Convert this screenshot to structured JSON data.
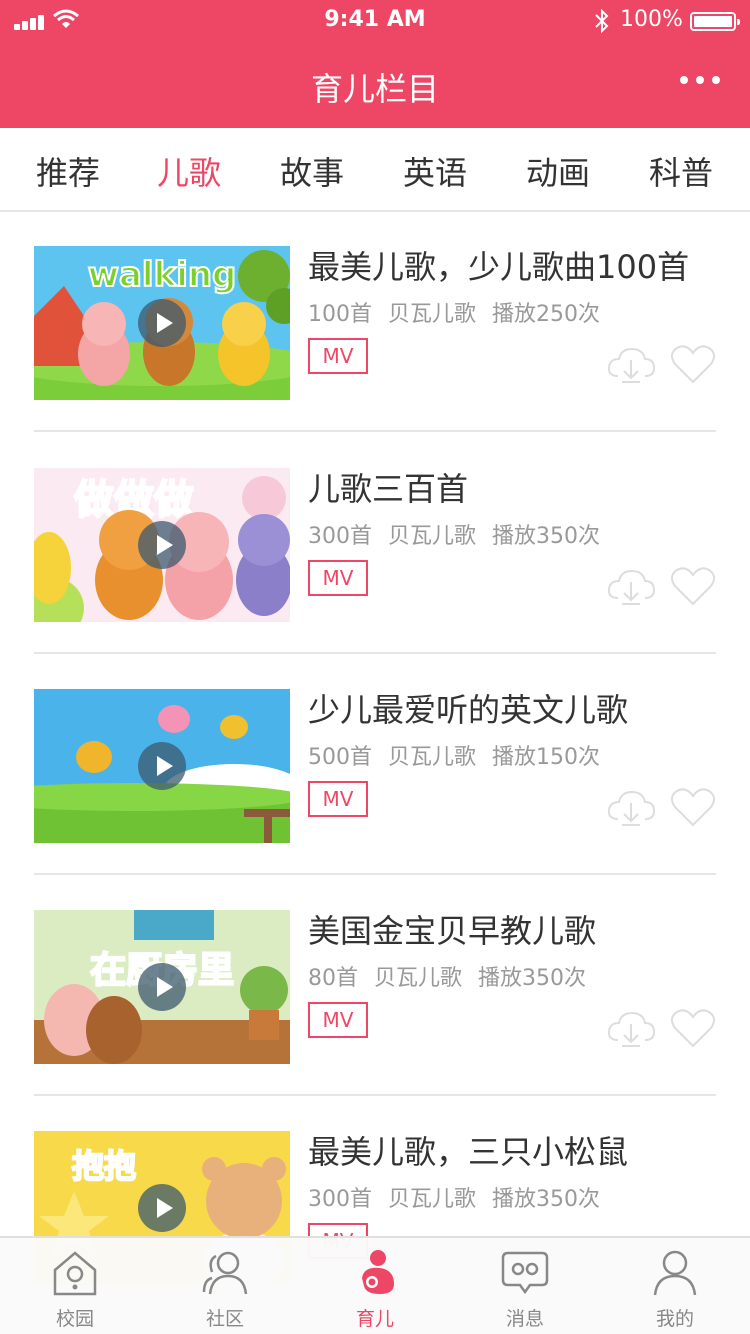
{
  "status_bar": {
    "time": "9:41 AM",
    "battery": "100%"
  },
  "nav": {
    "title": "育儿栏目"
  },
  "tabs": [
    {
      "label": "推荐"
    },
    {
      "label": "儿歌"
    },
    {
      "label": "故事"
    },
    {
      "label": "英语"
    },
    {
      "label": "动画"
    },
    {
      "label": "科普"
    }
  ],
  "active_tab": "儿歌",
  "items": [
    {
      "title": "最美儿歌，少儿歌曲100首",
      "count": "100首",
      "author": "贝瓦儿歌",
      "plays": "播放250次",
      "badge": "MV",
      "thumb_text": "walking"
    },
    {
      "title": "儿歌三百首",
      "count": "300首",
      "author": "贝瓦儿歌",
      "plays": "播放350次",
      "badge": "MV",
      "thumb_text": "做做做"
    },
    {
      "title": "少儿最爱听的英文儿歌",
      "count": "500首",
      "author": "贝瓦儿歌",
      "plays": "播放150次",
      "badge": "MV",
      "thumb_text": ""
    },
    {
      "title": "美国金宝贝早教儿歌",
      "count": "80首",
      "author": "贝瓦儿歌",
      "plays": "播放350次",
      "badge": "MV",
      "thumb_text": "在厨房里"
    },
    {
      "title": "最美儿歌，三只小松鼠",
      "count": "300首",
      "author": "贝瓦儿歌",
      "plays": "播放350次",
      "badge": "MV",
      "thumb_text": "抱抱"
    }
  ],
  "tabbar": [
    {
      "label": "校园",
      "icon": "school-icon"
    },
    {
      "label": "社区",
      "icon": "community-icon"
    },
    {
      "label": "育儿",
      "icon": "parenting-icon"
    },
    {
      "label": "消息",
      "icon": "message-icon"
    },
    {
      "label": "我的",
      "icon": "profile-icon"
    }
  ],
  "colors": {
    "accent": "#ee4766",
    "text": "#333333",
    "muted": "#999999",
    "divider": "#e6e6e6"
  }
}
